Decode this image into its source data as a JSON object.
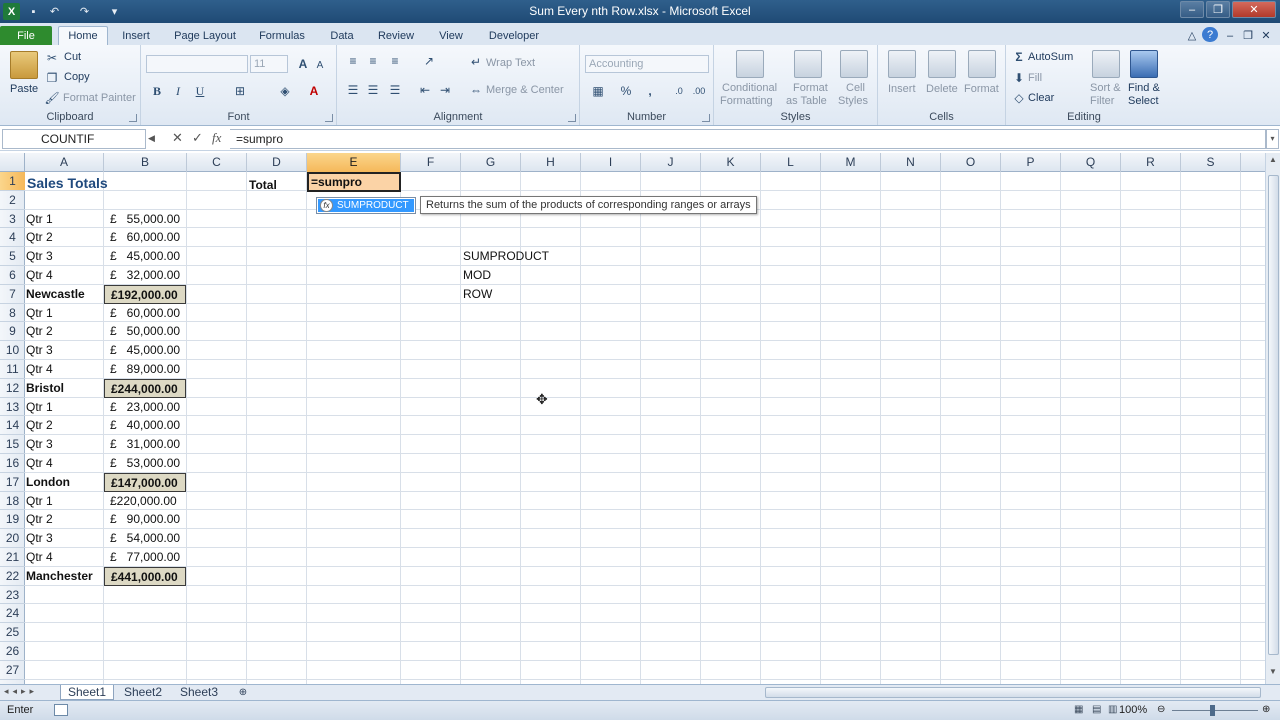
{
  "window": {
    "title": "Sum Every nth Row.xlsx  -  Microsoft Excel"
  },
  "tabs": [
    "File",
    "Home",
    "Insert",
    "Page Layout",
    "Formulas",
    "Data",
    "Review",
    "View",
    "Developer"
  ],
  "ribbon": {
    "clipboard": {
      "label": "Clipboard",
      "paste": "Paste",
      "cut": "Cut",
      "copy": "Copy",
      "format_painter": "Format Painter"
    },
    "font": {
      "label": "Font",
      "font_size": "11",
      "bold": "B",
      "italic": "I",
      "underline": "U"
    },
    "alignment": {
      "label": "Alignment",
      "wrap_text": "Wrap Text",
      "merge_center": "Merge & Center"
    },
    "number": {
      "label": "Number",
      "format": "Accounting"
    },
    "styles": {
      "label": "Styles",
      "conditional_formatting_1": "Conditional",
      "conditional_formatting_2": "Formatting",
      "format_as_table_1": "Format",
      "format_as_table_2": "as Table",
      "cell_styles_1": "Cell",
      "cell_styles_2": "Styles"
    },
    "cells": {
      "label": "Cells",
      "insert": "Insert",
      "delete": "Delete",
      "format": "Format"
    },
    "editing": {
      "label": "Editing",
      "autosum": "AutoSum",
      "fill": "Fill",
      "clear": "Clear",
      "sort_filter_1": "Sort &",
      "sort_filter_2": "Filter",
      "find_select_1": "Find &",
      "find_select_2": "Select"
    }
  },
  "formula_bar": {
    "name_box": "COUNTIF",
    "formula": "=sumpro",
    "fx": "fx"
  },
  "columns": [
    "A",
    "B",
    "C",
    "D",
    "E",
    "F",
    "G",
    "H",
    "I",
    "J",
    "K",
    "L",
    "M",
    "N",
    "O",
    "P",
    "Q",
    "R",
    "S"
  ],
  "rows": [
    "1",
    "2",
    "3",
    "4",
    "5",
    "6",
    "7",
    "8",
    "9",
    "10",
    "11",
    "12",
    "13",
    "14",
    "15",
    "16",
    "17",
    "18",
    "19",
    "20",
    "21",
    "22",
    "23",
    "24",
    "25",
    "26",
    "27"
  ],
  "sheet": {
    "title": "Sales Totals",
    "total_label": "Total",
    "active_cell_text": "=sumpro",
    "data_rows": [
      {
        "row": 3,
        "label": "Qtr 1",
        "value": "£   55,000.00"
      },
      {
        "row": 4,
        "label": "Qtr 2",
        "value": "£   60,000.00"
      },
      {
        "row": 5,
        "label": "Qtr 3",
        "value": "£   45,000.00"
      },
      {
        "row": 6,
        "label": "Qtr 4",
        "value": "£   32,000.00"
      },
      {
        "row": 7,
        "label": "Newcastle",
        "value": "£192,000.00",
        "total": true
      },
      {
        "row": 8,
        "label": "Qtr 1",
        "value": "£   60,000.00"
      },
      {
        "row": 9,
        "label": "Qtr 2",
        "value": "£   50,000.00"
      },
      {
        "row": 10,
        "label": "Qtr 3",
        "value": "£   45,000.00"
      },
      {
        "row": 11,
        "label": "Qtr 4",
        "value": "£   89,000.00"
      },
      {
        "row": 12,
        "label": "Bristol",
        "value": "£244,000.00",
        "total": true
      },
      {
        "row": 13,
        "label": "Qtr 1",
        "value": "£   23,000.00"
      },
      {
        "row": 14,
        "label": "Qtr 2",
        "value": "£   40,000.00"
      },
      {
        "row": 15,
        "label": "Qtr 3",
        "value": "£   31,000.00"
      },
      {
        "row": 16,
        "label": "Qtr 4",
        "value": "£   53,000.00"
      },
      {
        "row": 17,
        "label": "London",
        "value": "£147,000.00",
        "total": true
      },
      {
        "row": 18,
        "label": "Qtr 1",
        "value": "£220,000.00"
      },
      {
        "row": 19,
        "label": "Qtr 2",
        "value": "£   90,000.00"
      },
      {
        "row": 20,
        "label": "Qtr 3",
        "value": "£   54,000.00"
      },
      {
        "row": 21,
        "label": "Qtr 4",
        "value": "£   77,000.00"
      },
      {
        "row": 22,
        "label": "Manchester",
        "value": "£441,000.00",
        "total": true
      }
    ],
    "notes": [
      {
        "row": 5,
        "text": "SUMPRODUCT"
      },
      {
        "row": 6,
        "text": "MOD"
      },
      {
        "row": 7,
        "text": "ROW"
      }
    ]
  },
  "autocomplete": {
    "item": "SUMPRODUCT",
    "tooltip": "Returns the sum of the products of corresponding ranges or arrays"
  },
  "sheet_tabs": [
    "Sheet1",
    "Sheet2",
    "Sheet3"
  ],
  "status": {
    "mode": "Enter",
    "zoom": "100%"
  },
  "colors": {
    "total_fill": "#ddd9c4",
    "active_cell_fill": "#fbd3a6",
    "title_text": "#1f497d"
  }
}
